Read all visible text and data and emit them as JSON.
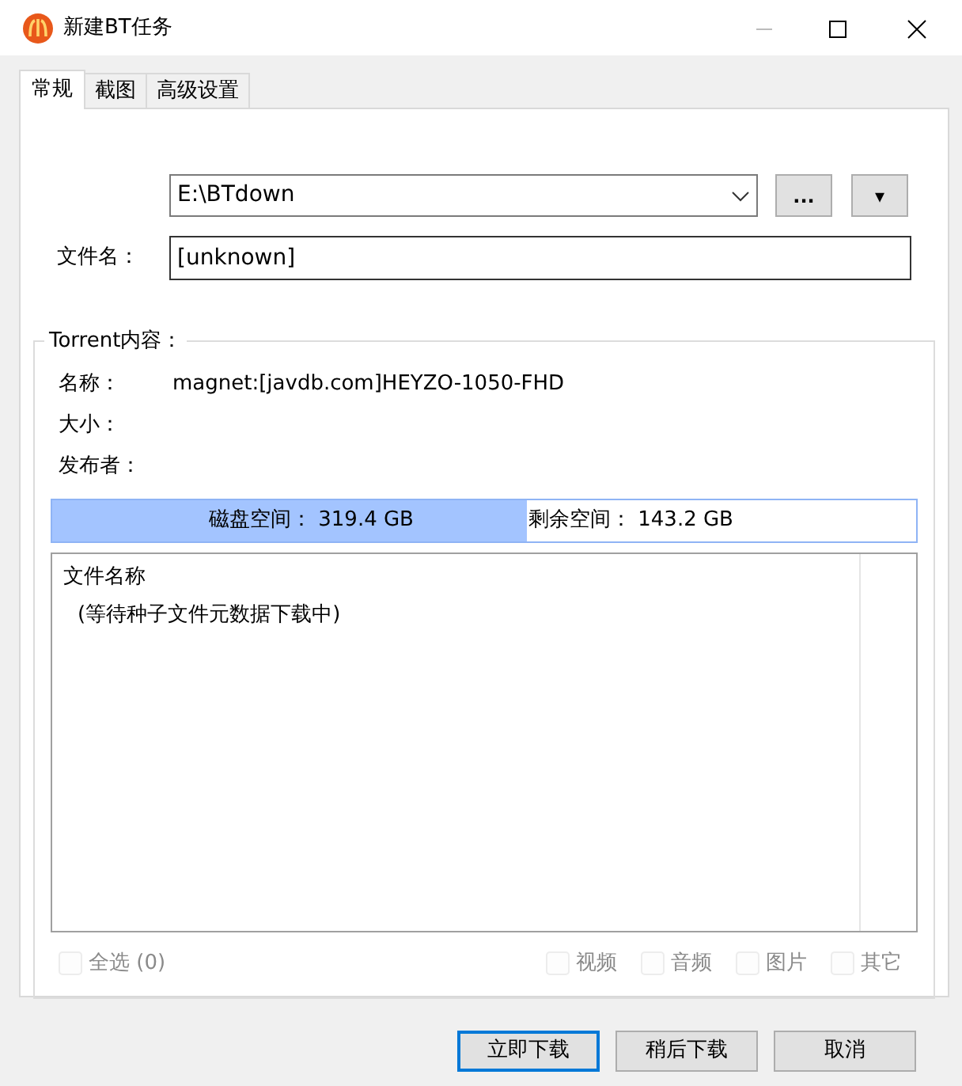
{
  "window": {
    "title": "新建BT任务"
  },
  "tabs": [
    {
      "label": "常规",
      "selected": true
    },
    {
      "label": "截图",
      "selected": false
    },
    {
      "label": "高级设置",
      "selected": false
    }
  ],
  "save_path": {
    "value": "E:\\BTdown",
    "browse_button": "...",
    "menu_button": "▾"
  },
  "file_name": {
    "label": "文件名：",
    "value": "[unknown]"
  },
  "torrent": {
    "title": "Torrent内容：",
    "fields": [
      {
        "label": "名称：",
        "value": "magnet:[javdb.com]HEYZO-1050-FHD"
      },
      {
        "label": "大小："
      },
      {
        "label": "发布者："
      }
    ]
  },
  "disk": {
    "level": 0.55,
    "total": "磁盘空间：  319.4 GB",
    "free": "剩余空间：  143.2 GB"
  },
  "file_list": {
    "column": "文件名称",
    "message": "(等待种子文件元数据下载中)"
  },
  "select_all": {
    "label": "全选 (0)",
    "checked": false,
    "disabled": true
  },
  "filters": [
    {
      "label": "视频",
      "checked": false,
      "disabled": true
    },
    {
      "label": "音频",
      "checked": false,
      "disabled": true
    },
    {
      "label": "图片",
      "checked": false,
      "disabled": true
    },
    {
      "label": "其它",
      "checked": false,
      "disabled": true
    }
  ],
  "buttons": [
    {
      "label": "立即下载",
      "default": true
    },
    {
      "label": "稍后下载",
      "default": false
    },
    {
      "label": "取消",
      "default": false
    }
  ]
}
